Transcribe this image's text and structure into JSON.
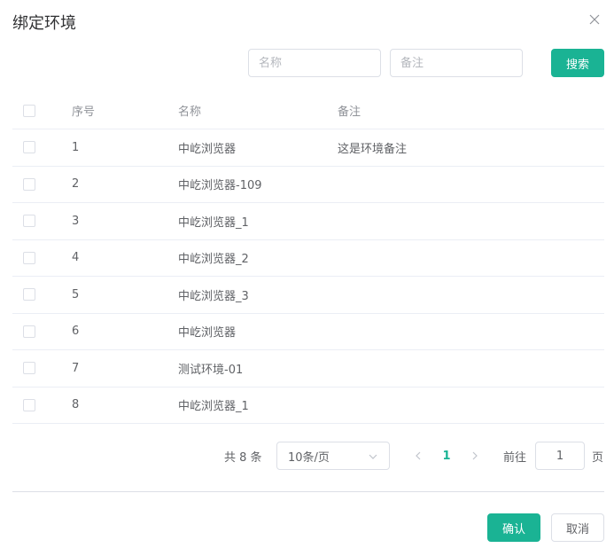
{
  "dialog": {
    "title": "绑定环境",
    "close_icon": "close-icon"
  },
  "search": {
    "name_placeholder": "名称",
    "name_value": "",
    "note_placeholder": "备注",
    "note_value": "",
    "button_label": "搜索"
  },
  "table": {
    "headers": {
      "index": "序号",
      "name": "名称",
      "note": "备注"
    },
    "rows": [
      {
        "index": "1",
        "name": "中屹浏览器",
        "note": "这是环境备注"
      },
      {
        "index": "2",
        "name": "中屹浏览器-109",
        "note": ""
      },
      {
        "index": "3",
        "name": "中屹浏览器_1",
        "note": ""
      },
      {
        "index": "4",
        "name": "中屹浏览器_2",
        "note": ""
      },
      {
        "index": "5",
        "name": "中屹浏览器_3",
        "note": ""
      },
      {
        "index": "6",
        "name": "中屹浏览器",
        "note": ""
      },
      {
        "index": "7",
        "name": "测试环境-01",
        "note": ""
      },
      {
        "index": "8",
        "name": "中屹浏览器_1",
        "note": ""
      }
    ]
  },
  "pagination": {
    "total_text": "共 8 条",
    "page_size_selected": "10条/页",
    "current_page": "1",
    "goto_label": "前往",
    "goto_value": "1",
    "page_unit": "页"
  },
  "footer": {
    "confirm_label": "确认",
    "cancel_label": "取消"
  },
  "colors": {
    "accent": "#1ab394",
    "border": "#dcdfe6",
    "row_border": "#ebeef5",
    "text": "#606266",
    "header_text": "#909399",
    "title": "#303133"
  }
}
